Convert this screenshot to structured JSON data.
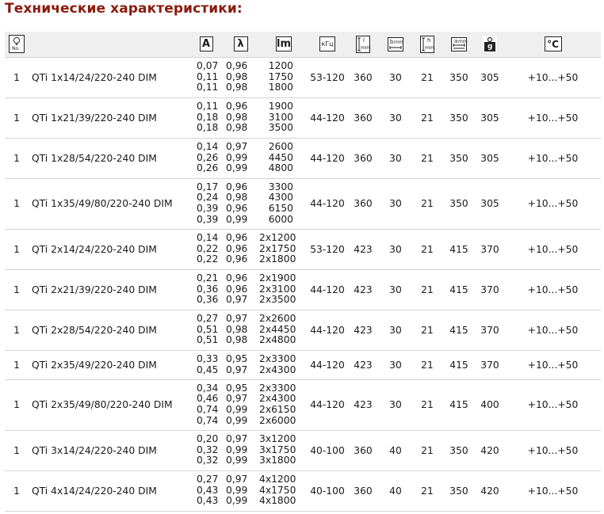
{
  "title": "Технические характеристики:",
  "header": {
    "amp_label": "A",
    "lambda_label": "λ",
    "lm_label": "lm",
    "freq_label": "кГц",
    "l_label": "l",
    "l_unit": "mm",
    "b_label": "b",
    "b_unit": "mm",
    "h_label": "h",
    "h_unit": "mm",
    "a_label": "a",
    "a_unit": "mm",
    "g_label": "g",
    "temp_label": "°C",
    "no_label": "No."
  },
  "rows": [
    {
      "qty": "1",
      "name": "QTi 1x14/24/220-240 DIM",
      "a": [
        "0,07",
        "0,11",
        "0,11"
      ],
      "lambda": [
        "0,96",
        "0,98",
        "0,98"
      ],
      "lm": [
        "1200",
        "1750",
        "1800"
      ],
      "freq": "53-120",
      "l": "360",
      "b": "30",
      "h": "21",
      "am": "350",
      "g": "305",
      "temp": "+10...+50"
    },
    {
      "qty": "1",
      "name": "QTi 1x21/39/220-240 DIM",
      "a": [
        "0,11",
        "0,18",
        "0,18"
      ],
      "lambda": [
        "0,96",
        "0,98",
        "0,98"
      ],
      "lm": [
        "1900",
        "3100",
        "3500"
      ],
      "freq": "44-120",
      "l": "360",
      "b": "30",
      "h": "21",
      "am": "350",
      "g": "305",
      "temp": "+10...+50"
    },
    {
      "qty": "1",
      "name": "QTi 1x28/54/220-240 DIM",
      "a": [
        "0,14",
        "0,26",
        "0,26"
      ],
      "lambda": [
        "0,97",
        "0,99",
        "0,99"
      ],
      "lm": [
        "2600",
        "4450",
        "4800"
      ],
      "freq": "44-120",
      "l": "360",
      "b": "30",
      "h": "21",
      "am": "350",
      "g": "305",
      "temp": "+10...+50"
    },
    {
      "qty": "1",
      "name": "QTi 1x35/49/80/220-240 DIM",
      "a": [
        "0,17",
        "0,24",
        "0,39",
        "0,39"
      ],
      "lambda": [
        "0,96",
        "0,98",
        "0,96",
        "0,99"
      ],
      "lm": [
        "3300",
        "4300",
        "6150",
        "6000"
      ],
      "freq": "44-120",
      "l": "360",
      "b": "30",
      "h": "21",
      "am": "350",
      "g": "305",
      "temp": "+10...+50"
    },
    {
      "qty": "1",
      "name": "QTi 2x14/24/220-240 DIM",
      "a": [
        "0,14",
        "0,22",
        "0,22"
      ],
      "lambda": [
        "0,96",
        "0,96",
        "0,96"
      ],
      "lm": [
        "2x1200",
        "2x1750",
        "2x1800"
      ],
      "freq": "53-120",
      "l": "423",
      "b": "30",
      "h": "21",
      "am": "415",
      "g": "370",
      "temp": "+10...+50"
    },
    {
      "qty": "1",
      "name": "QTi 2x21/39/220-240 DIM",
      "a": [
        "0,21",
        "0,36",
        "0,36"
      ],
      "lambda": [
        "0,96",
        "0,96",
        "0,97"
      ],
      "lm": [
        "2x1900",
        "2x3100",
        "2x3500"
      ],
      "freq": "44-120",
      "l": "423",
      "b": "30",
      "h": "21",
      "am": "415",
      "g": "370",
      "temp": "+10...+50"
    },
    {
      "qty": "1",
      "name": "QTi 2x28/54/220-240 DIM",
      "a": [
        "0,27",
        "0,51",
        "0,51"
      ],
      "lambda": [
        "0,97",
        "0,98",
        "0,98"
      ],
      "lm": [
        "2x2600",
        "2x4450",
        "2x4800"
      ],
      "freq": "44-120",
      "l": "423",
      "b": "30",
      "h": "21",
      "am": "415",
      "g": "370",
      "temp": "+10...+50"
    },
    {
      "qty": "1",
      "name": "QTi 2x35/49/220-240 DIM",
      "a": [
        "0,33",
        "0,45"
      ],
      "lambda": [
        "0,95",
        "0,97"
      ],
      "lm": [
        "2x3300",
        "2x4300"
      ],
      "freq": "44-120",
      "l": "423",
      "b": "30",
      "h": "21",
      "am": "415",
      "g": "370",
      "temp": "+10...+50"
    },
    {
      "qty": "1",
      "name": "QTi 2x35/49/80/220-240 DIM",
      "a": [
        "0,34",
        "0,46",
        "0,74",
        "0,74"
      ],
      "lambda": [
        "0,95",
        "0,97",
        "0,99",
        "0,99"
      ],
      "lm": [
        "2x3300",
        "2x4300",
        "2x6150",
        "2x6000"
      ],
      "freq": "44-120",
      "l": "423",
      "b": "30",
      "h": "21",
      "am": "415",
      "g": "400",
      "temp": "+10...+50"
    },
    {
      "qty": "1",
      "name": "QTi 3x14/24/220-240 DIM",
      "a": [
        "0,20",
        "0,32",
        "0,32"
      ],
      "lambda": [
        "0,97",
        "0,99",
        "0,99"
      ],
      "lm": [
        "3x1200",
        "3x1750",
        "3x1800"
      ],
      "freq": "40-100",
      "l": "360",
      "b": "40",
      "h": "21",
      "am": "350",
      "g": "420",
      "temp": "+10...+50"
    },
    {
      "qty": "1",
      "name": "QTi 4x14/24/220-240 DIM",
      "a": [
        "0,27",
        "0,43",
        "0,43"
      ],
      "lambda": [
        "0,97",
        "0,99",
        "0,99"
      ],
      "lm": [
        "4x1200",
        "4x1750",
        "4x1800"
      ],
      "freq": "40-100",
      "l": "360",
      "b": "40",
      "h": "21",
      "am": "350",
      "g": "420",
      "temp": "+10...+50"
    }
  ]
}
